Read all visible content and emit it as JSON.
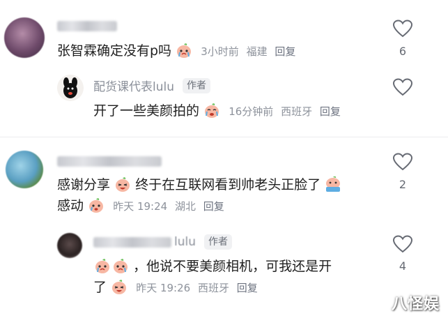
{
  "comments": [
    {
      "text": "张智霖确定没有p吗",
      "time": "3小时前",
      "location": "福建",
      "reply_label": "回复",
      "likes": "6",
      "avatar_icon": "user-avatar-blurred-purple"
    },
    {
      "author": "配货课代表lulu",
      "author_badge": "作者",
      "text": "开了一些美颜拍的",
      "time": "16分钟前",
      "location": "西班牙",
      "reply_label": "回复",
      "avatar_icon": "black-dog-avatar"
    },
    {
      "text_line1_a": "感谢分享",
      "text_line1_b": "终于在互联网看到帅老头正脸了",
      "text_line2": "感动",
      "time": "昨天 19:24",
      "location": "湖北",
      "reply_label": "回复",
      "likes": "2",
      "avatar_icon": "user-avatar-blurred-blue"
    },
    {
      "author_suffix": "lulu",
      "author_badge": "作者",
      "text_line1": "，他说不要美颜相机，可我还是开",
      "text_line2": "了",
      "time": "昨天 19:26",
      "location": "西班牙",
      "reply_label": "回复",
      "likes": "4",
      "avatar_icon": "user-avatar-blurred-dark"
    }
  ],
  "watermark": "八怪娱",
  "colors": {
    "text": "#1f1f1f",
    "meta": "#8d929b",
    "heart": "#666a73",
    "divider": "#ececee"
  }
}
